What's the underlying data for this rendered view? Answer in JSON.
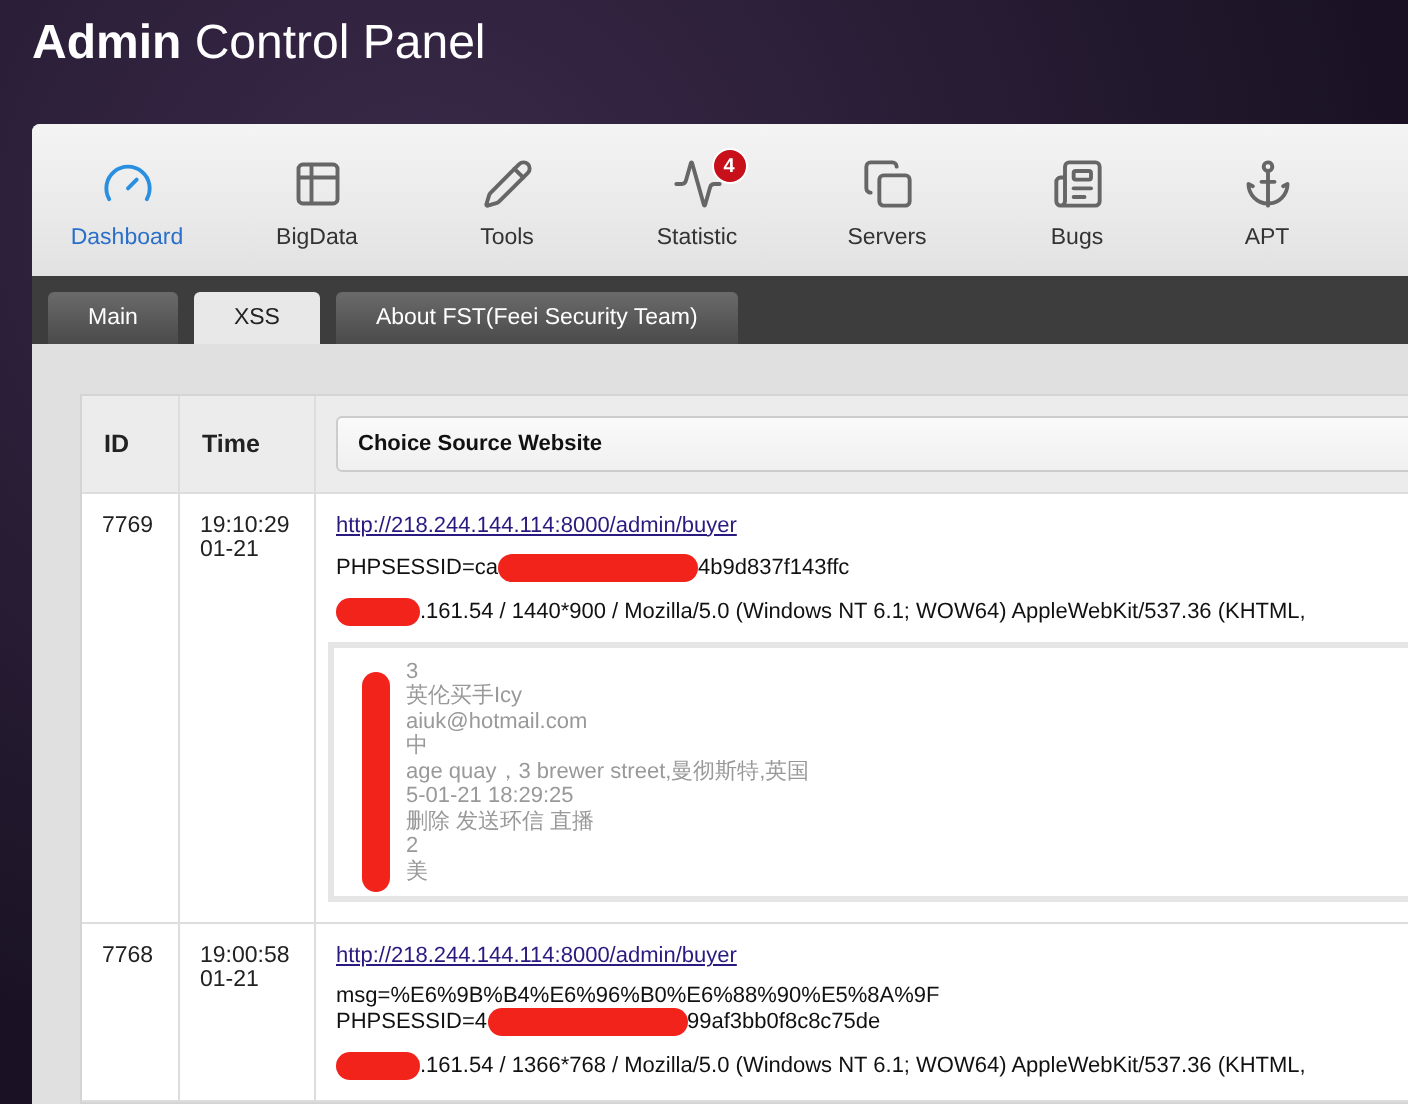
{
  "header": {
    "title": "**Admin** Control Panel"
  },
  "nav": [
    {
      "label": "Dashboard",
      "selected": true
    },
    {
      "label": "BigData",
      "selected": false
    },
    {
      "label": "Tools",
      "selected": false
    },
    {
      "label": "Statistic",
      "selected": false,
      "badge": "4"
    },
    {
      "label": "Servers",
      "selected": false
    },
    {
      "label": "Bugs",
      "selected": false
    },
    {
      "label": "APT",
      "selected": false
    }
  ],
  "tabs": [
    {
      "label": "Main",
      "selected": false
    },
    {
      "label": "XSS",
      "selected": true
    },
    {
      "label": "About FST(Feei Security Team)",
      "selected": false
    }
  ],
  "table": {
    "columns": [
      "ID",
      "Time"
    ],
    "source_select": "Choice Source Website",
    "rows": [
      {
        "id": "7769",
        "time": [
          "19:10:29",
          "01-21"
        ],
        "url": "http://218.244.144.114:8000/admin/buyer",
        "params": [],
        "cookie": [
          "PHPSESSID=ca",
          "4b9d837f143ffc"
        ],
        "client": ".161.54 / 1440*900 / Mozilla/5.0 (Windows NT 6.1; WOW64) AppleWebKit/537.36 (KHTML,",
        "content": [
          "3",
          "英伦买手Icy",
          "aiuk@hotmail.com",
          "中",
          "age quay，3 brewer street,曼彻斯特,英国",
          "5-01-21 18:29:25",
          "删除 发送环信 直播",
          "2",
          "美"
        ]
      },
      {
        "id": "7768",
        "time": [
          "19:00:58",
          "01-21"
        ],
        "url": "http://218.244.144.114:8000/admin/buyer",
        "params": [
          "msg=%E6%9B%B4%E6%96%B0%E6%88%90%E5%8A%9F"
        ],
        "cookie": [
          "PHPSESSID=4",
          "99af3bb0f8c8c75de"
        ],
        "client": ".161.54 / 1366*768 / Mozilla/5.0 (Windows NT 6.1; WOW64) AppleWebKit/537.36 (KHTML,",
        "content": []
      }
    ]
  }
}
